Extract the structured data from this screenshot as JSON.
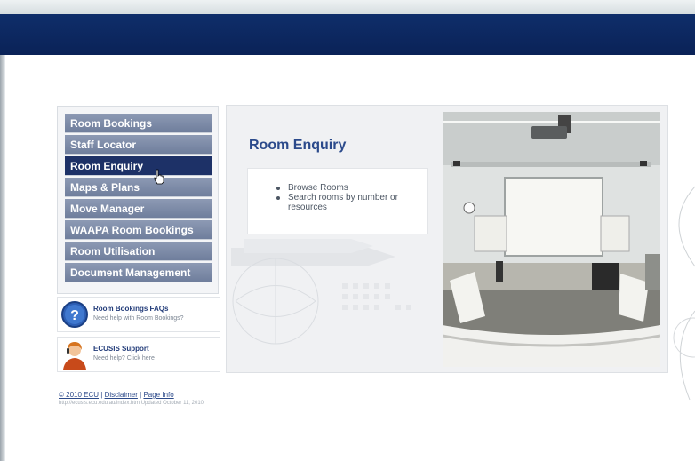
{
  "nav": {
    "items": [
      {
        "label": "Room Bookings",
        "active": false
      },
      {
        "label": "Staff Locator",
        "active": false
      },
      {
        "label": "Room Enquiry",
        "active": true
      },
      {
        "label": "Maps & Plans",
        "active": false
      },
      {
        "label": "Move Manager",
        "active": false
      },
      {
        "label": "WAAPA Room Bookings",
        "active": false
      },
      {
        "label": "Room Utilisation",
        "active": false
      },
      {
        "label": "Document Management",
        "active": false
      }
    ]
  },
  "help": {
    "faq_title": "Room Bookings FAQs",
    "faq_sub": "Need help with Room Bookings?",
    "support_title": "ECUSIS Support",
    "support_sub": "Need help? Click here"
  },
  "panel": {
    "title": "Room Enquiry",
    "bullets": [
      "Browse Rooms",
      "Search rooms by number or resources"
    ]
  },
  "footer": {
    "copyright": "© 2010 ECU",
    "sep1": " | ",
    "disclaimer": "Disclaimer",
    "sep2": " | ",
    "page_info": "Page Info",
    "url_line": "http://ecusis.ecu.edu.au/index.htm Updated October 11, 2010"
  },
  "colors": {
    "header": "#0f2e6a",
    "nav_item": "#7f8da9",
    "nav_active": "#1d3167",
    "title": "#2b4a8b"
  }
}
